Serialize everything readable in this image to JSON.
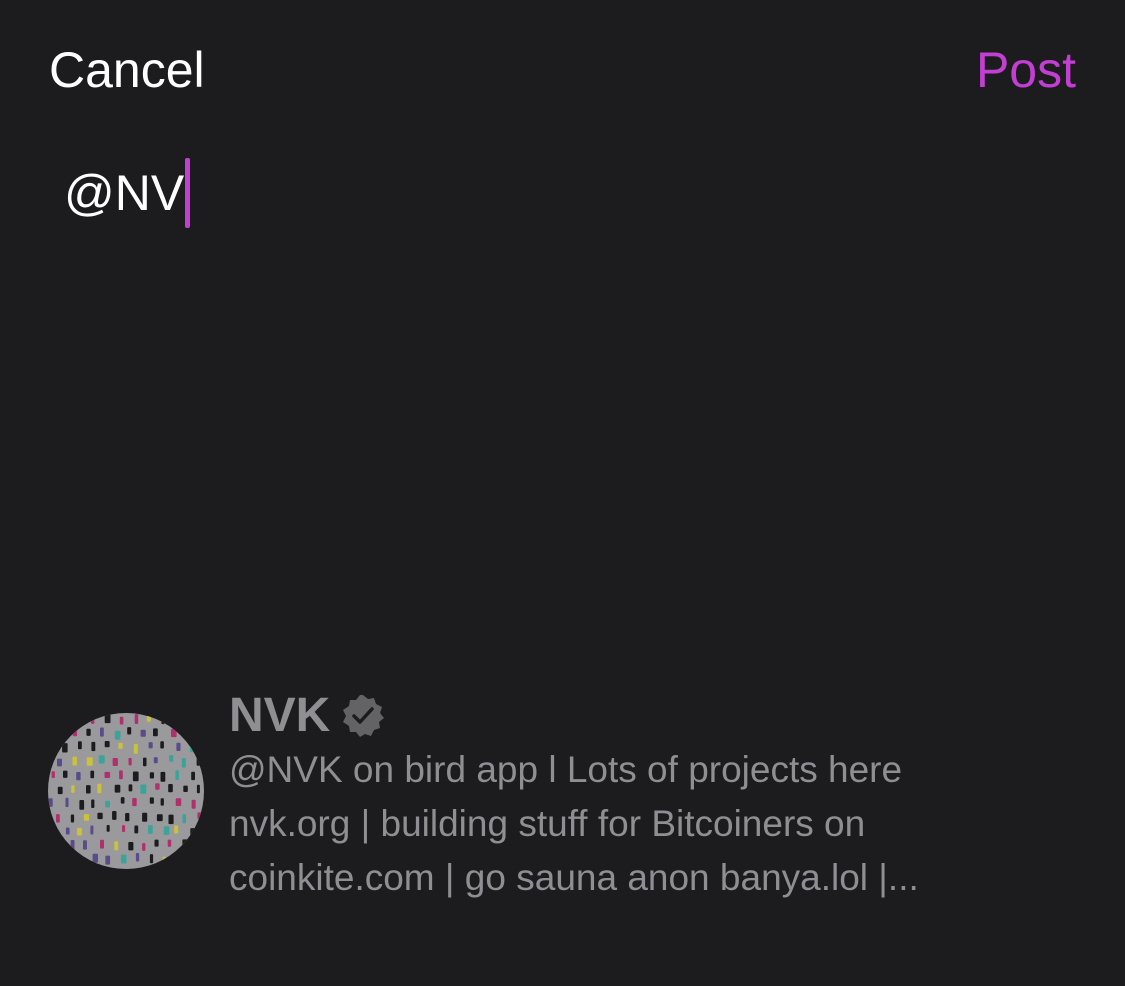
{
  "header": {
    "cancel_label": "Cancel",
    "post_label": "Post"
  },
  "composer": {
    "text": "@NV"
  },
  "suggestions": [
    {
      "display_name": "NVK",
      "verified_icon": "verified-badge-icon",
      "bio_line_1": "@NVK on bird app l Lots of projects here",
      "bio_line_2": "nvk.org | building stuff for Bitcoiners on",
      "bio_line_3": "coinkite.com | go sauna anon banya.lol |..."
    }
  ],
  "colors": {
    "background": "#1c1c1e",
    "accent": "#c33fd4",
    "primary_text": "#ffffff",
    "secondary_text": "#8e8e93"
  }
}
